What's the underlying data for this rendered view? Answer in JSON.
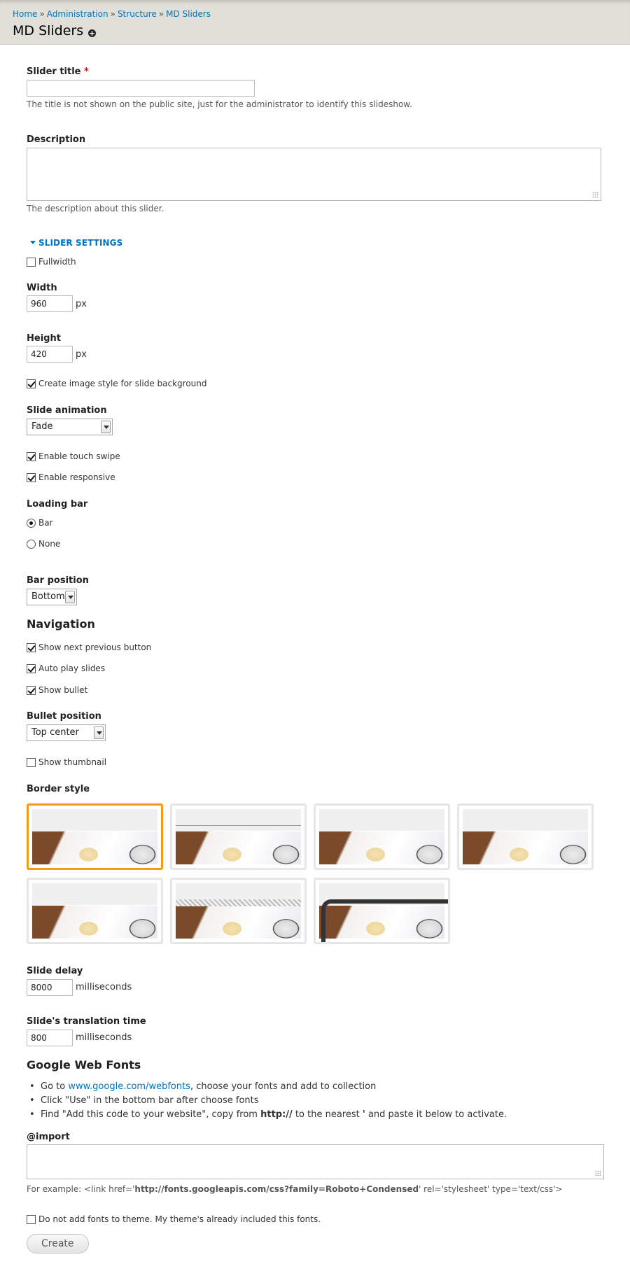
{
  "breadcrumb": [
    "Home",
    "Administration",
    "Structure",
    "MD Sliders"
  ],
  "breadcrumb_sep": "»",
  "page_title": "MD Sliders",
  "title_icon": "plus-circle-icon",
  "slider_title": {
    "label": "Slider title",
    "required_mark": "*",
    "value": "",
    "description": "The title is not shown on the public site, just for the administrator to identify this slideshow."
  },
  "description_field": {
    "label": "Description",
    "value": "",
    "description": "The description about this slider."
  },
  "slider_settings": {
    "legend": "SLIDER SETTINGS",
    "fullwidth": {
      "label": "Fullwidth",
      "checked": false
    },
    "width": {
      "label": "Width",
      "value": "960",
      "unit": "px"
    },
    "height": {
      "label": "Height",
      "value": "420",
      "unit": "px"
    },
    "image_style": {
      "label": "Create image style for slide background",
      "checked": true
    },
    "slide_animation": {
      "label": "Slide animation",
      "value": "Fade"
    },
    "touch_swipe": {
      "label": "Enable touch swipe",
      "checked": true
    },
    "responsive": {
      "label": "Enable responsive",
      "checked": true
    },
    "loading_bar": {
      "label": "Loading bar",
      "options": [
        "Bar",
        "None"
      ],
      "selected": "Bar"
    },
    "bar_position": {
      "label": "Bar position",
      "value": "Bottom"
    }
  },
  "navigation": {
    "heading": "Navigation",
    "next_prev": {
      "label": "Show next previous button",
      "checked": true
    },
    "auto_play": {
      "label": "Auto play slides",
      "checked": true
    },
    "show_bullet": {
      "label": "Show bullet",
      "checked": true
    },
    "bullet_position": {
      "label": "Bullet position",
      "value": "Top center"
    },
    "show_thumbnail": {
      "label": "Show thumbnail",
      "checked": false
    }
  },
  "border_style": {
    "label": "Border style",
    "selected_index": 0,
    "count": 7
  },
  "slide_delay": {
    "label": "Slide delay",
    "value": "8000",
    "unit": "milliseconds"
  },
  "translation_time": {
    "label": "Slide's translation time",
    "value": "800",
    "unit": "milliseconds"
  },
  "google_fonts": {
    "heading": "Google Web Fonts",
    "item1_pre": "Go to ",
    "item1_link": "www.google.com/webfonts",
    "item1_post": ", choose your fonts and add to collection",
    "item2": "Click \"Use\" in the bottom bar after choose fonts",
    "item3_pre": "Find \"Add this code to your website\", copy from ",
    "item3_bold1": "http://",
    "item3_mid": " to the nearest ",
    "item3_bold2": "'",
    "item3_post": " and paste it below to activate."
  },
  "import_field": {
    "label": "@import",
    "value": "",
    "example_pre": "For example: <link href='",
    "example_bold": "http://fonts.googleapis.com/css?family=Roboto+Condensed",
    "example_post": "' rel='stylesheet' type='text/css'>"
  },
  "no_fonts": {
    "label": "Do not add fonts to theme. My theme's already included this fonts.",
    "checked": false
  },
  "create_button": "Create",
  "colors": {
    "link": "#0074bd",
    "selected_border": "#f39c12",
    "required": "#e00000",
    "header_bg": "#e0e0d8"
  }
}
